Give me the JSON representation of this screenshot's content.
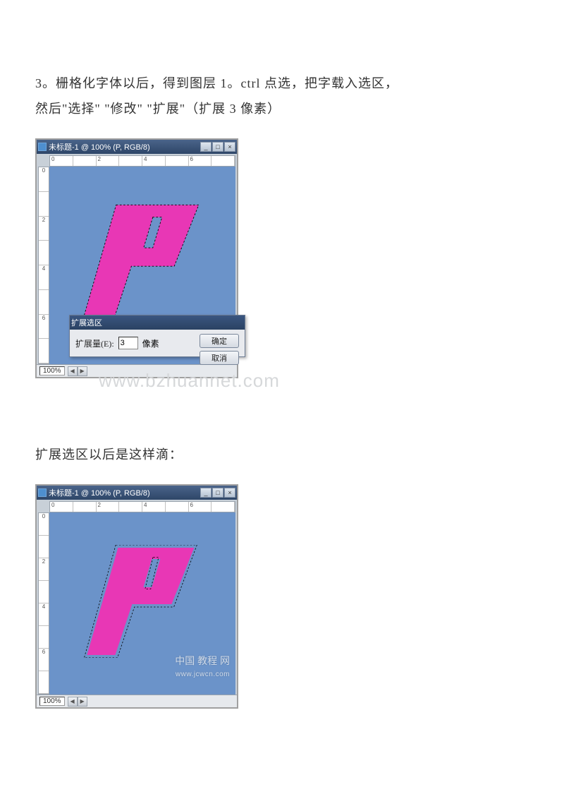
{
  "text": {
    "line1": "3。栅格化字体以后，得到图层 1。ctrl 点选，把字载入选区，",
    "line2": "然后\"选择\"  \"修改\"  \"扩展\"（扩展 3 像素）",
    "line3": "扩展选区以后是这样滴："
  },
  "window": {
    "title": "未标题-1 @ 100% (P, RGB/8)",
    "btn_min": "_",
    "btn_max": "□",
    "btn_close": "×",
    "rulers_h": [
      "0",
      "",
      "2",
      "",
      "4",
      "",
      "6",
      ""
    ],
    "rulers_v": [
      "0",
      "",
      "2",
      "",
      "4",
      "",
      "6",
      ""
    ],
    "zoom": "100%",
    "canvas_bg": "#6b93c9",
    "shape_fill": "#e837b5"
  },
  "dialog": {
    "title": "扩展选区",
    "label": "扩展量(E):",
    "value": "3",
    "unit": "像素",
    "ok": "确定",
    "cancel": "取消"
  },
  "watermark": {
    "url": "www.bzhuannet.com",
    "cn": "中国 教程 网",
    "cn_sub": "www.jcwcn.com"
  }
}
